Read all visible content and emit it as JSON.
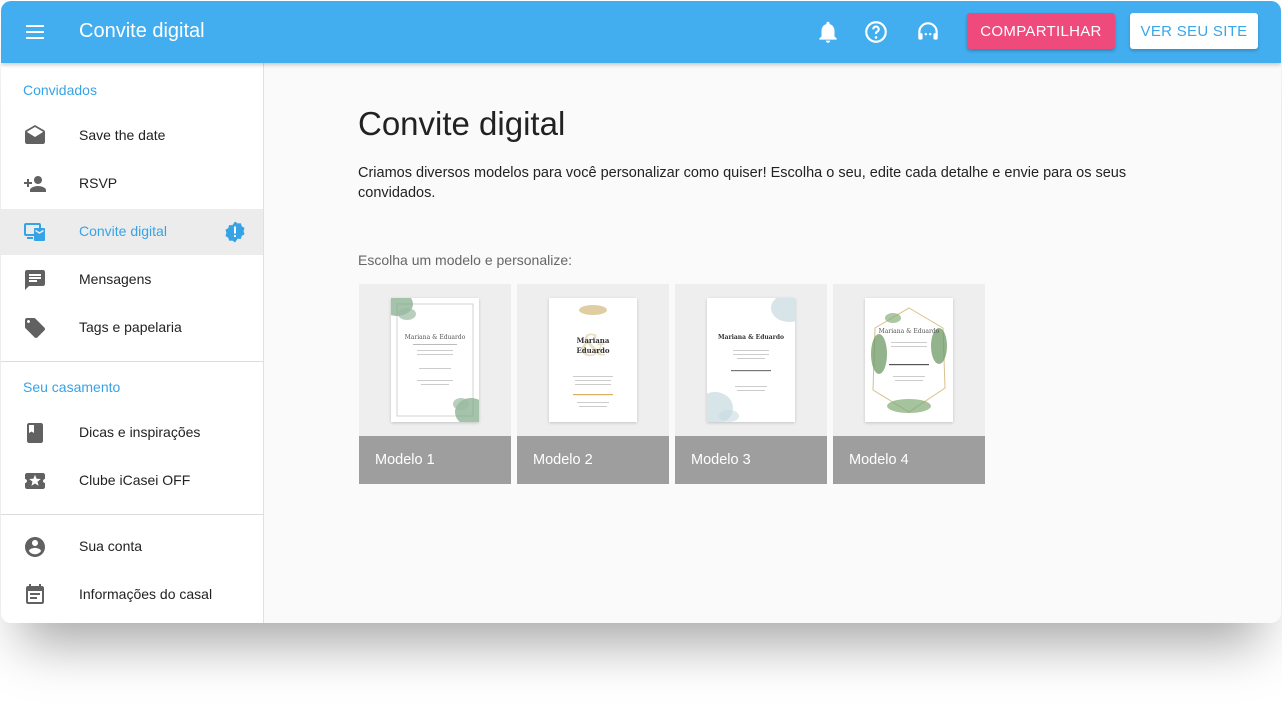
{
  "header": {
    "title": "Convite digital",
    "share_label": "COMPARTILHAR",
    "site_label": "VER SEU SITE"
  },
  "sidebar": {
    "sections": [
      {
        "title": "Convidados",
        "items": [
          {
            "label": "Save the date",
            "icon": "envelope-open-icon"
          },
          {
            "label": "RSVP",
            "icon": "person-add-icon"
          },
          {
            "label": "Convite digital",
            "icon": "devices-mail-icon",
            "active": true,
            "badge": "alert-badge-icon"
          },
          {
            "label": "Mensagens",
            "icon": "chat-icon"
          },
          {
            "label": "Tags e papelaria",
            "icon": "tag-icon"
          }
        ]
      },
      {
        "title": "Seu casamento",
        "items": [
          {
            "label": "Dicas e inspirações",
            "icon": "book-icon"
          },
          {
            "label": "Clube iCasei OFF",
            "icon": "ticket-star-icon"
          }
        ]
      },
      {
        "title": "",
        "items": [
          {
            "label": "Sua conta",
            "icon": "account-circle-icon"
          },
          {
            "label": "Informações do casal",
            "icon": "calendar-icon"
          }
        ]
      }
    ]
  },
  "main": {
    "title": "Convite digital",
    "description": "Criamos diversos modelos para você personalizar como quiser! Escolha o seu, edite cada detalhe e envie para os seus convidados.",
    "choose_label": "Escolha um modelo e personalize:",
    "models": [
      {
        "label": "Modelo 1",
        "names": "Mariana & Eduardo"
      },
      {
        "label": "Modelo 2",
        "names": "Mariana Eduardo"
      },
      {
        "label": "Modelo 3",
        "names": "Mariana & Eduardo"
      },
      {
        "label": "Modelo 4",
        "names": "Mariana & Eduardo"
      }
    ]
  },
  "colors": {
    "appbar": "#42aef0",
    "accent": "#36a3e6",
    "share_button": "#ee4a7c",
    "caption": "#9e9e9e"
  }
}
